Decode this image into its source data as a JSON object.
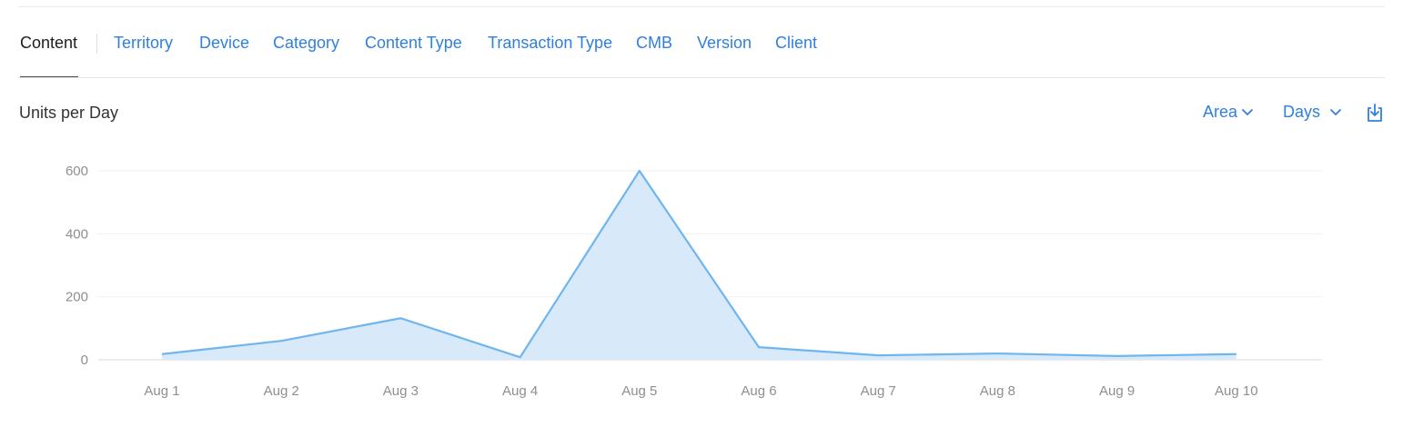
{
  "tabs": [
    {
      "label": "Content",
      "active": true
    },
    {
      "label": "Territory",
      "active": false
    },
    {
      "label": "Device",
      "active": false
    },
    {
      "label": "Category",
      "active": false
    },
    {
      "label": "Content Type",
      "active": false
    },
    {
      "label": "Transaction Type",
      "active": false
    },
    {
      "label": "CMB",
      "active": false
    },
    {
      "label": "Version",
      "active": false
    },
    {
      "label": "Client",
      "active": false
    }
  ],
  "controls": {
    "chart_style_label": "Area",
    "interval_label": "Days",
    "export_icon": "download-icon"
  },
  "colors": {
    "accent": "#2f7fde",
    "line": "#6fb5ee",
    "fill": "#d8eaf9",
    "grid": "#efeff1",
    "axis_text": "#8e8e93"
  },
  "chart_data": {
    "type": "area",
    "title": "Units per Day",
    "xlabel": "",
    "ylabel": "",
    "categories": [
      "Aug 1",
      "Aug 2",
      "Aug 3",
      "Aug 4",
      "Aug 5",
      "Aug 6",
      "Aug 7",
      "Aug 8",
      "Aug 9",
      "Aug 10"
    ],
    "series": [
      {
        "values": [
          18,
          60,
          132,
          8,
          600,
          40,
          14,
          20,
          12,
          18
        ]
      }
    ],
    "yticks": [
      0,
      200,
      400,
      600
    ],
    "ylim": [
      0,
      600
    ],
    "grid": true,
    "legend": "none"
  }
}
